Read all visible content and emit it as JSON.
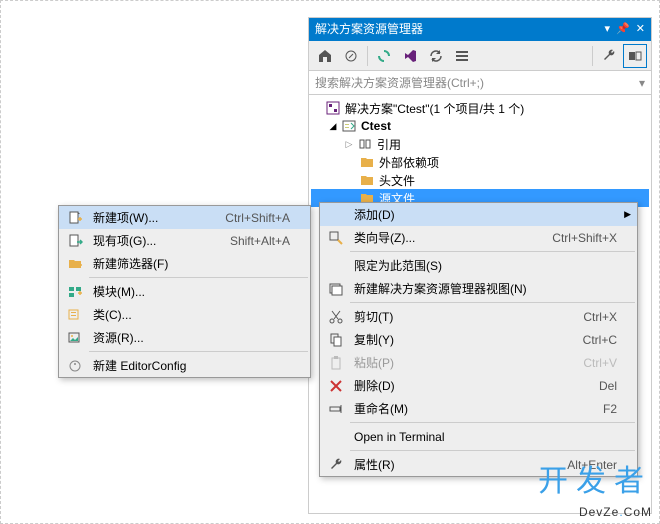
{
  "panel": {
    "title": "解决方案资源管理器",
    "search_placeholder": "搜索解决方案资源管理器(Ctrl+;)",
    "solution_label": "解决方案\"Ctest\"(1 个项目/共 1 个)",
    "project_label": "Ctest",
    "nodes": {
      "references": "引用",
      "external_deps": "外部依赖项",
      "headers": "头文件",
      "sources": "源文件"
    }
  },
  "context_main": {
    "add": "添加(D)",
    "class_wizard": {
      "label": "类向导(Z)...",
      "shortcut": "Ctrl+Shift+X"
    },
    "scope": "限定为此范围(S)",
    "new_view": "新建解决方案资源管理器视图(N)",
    "cut": {
      "label": "剪切(T)",
      "shortcut": "Ctrl+X"
    },
    "copy": {
      "label": "复制(Y)",
      "shortcut": "Ctrl+C"
    },
    "paste": {
      "label": "粘贴(P)",
      "shortcut": "Ctrl+V"
    },
    "delete": {
      "label": "删除(D)",
      "shortcut": "Del"
    },
    "rename": {
      "label": "重命名(M)",
      "shortcut": "F2"
    },
    "terminal": "Open in Terminal",
    "properties": {
      "label": "属性(R)",
      "shortcut": "Alt+Enter"
    }
  },
  "context_sub": {
    "new_item": {
      "label": "新建项(W)...",
      "shortcut": "Ctrl+Shift+A"
    },
    "existing_item": {
      "label": "现有项(G)...",
      "shortcut": "Shift+Alt+A"
    },
    "new_filter": "新建筛选器(F)",
    "module": "模块(M)...",
    "class": "类(C)...",
    "resource": "资源(R)...",
    "editorconfig": "新建 EditorConfig"
  },
  "watermark": {
    "cn": "开发者",
    "en_pre": "DevZe",
    "en_dot": ".",
    "en_post": "CoM"
  }
}
